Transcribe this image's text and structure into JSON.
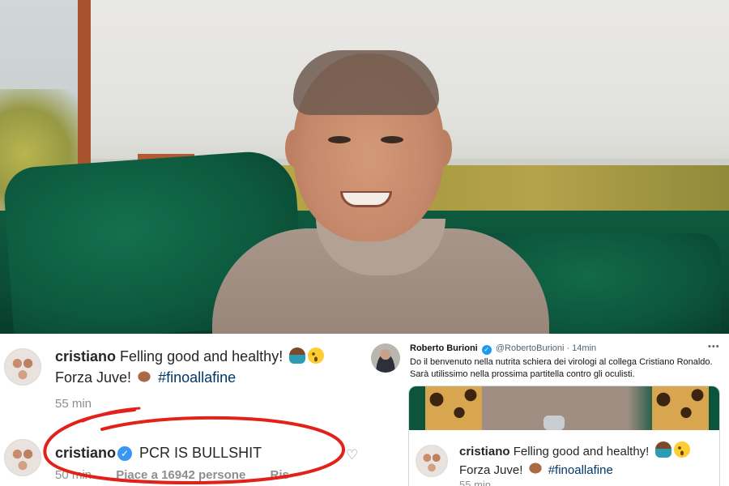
{
  "instagram": {
    "comment1": {
      "user": "cristiano",
      "text": "Felling good and healthy!",
      "emojis": [
        "person-shrugging-emoji",
        "winking-face-emoji"
      ],
      "line2": "Forza Juve!",
      "line2_emoji": "flexed-biceps-emoji",
      "hashtag": "#finoallafine",
      "time": "55 min"
    },
    "comment2": {
      "user": "cristiano",
      "text": "PCR IS BULLSHIT",
      "time": "50 min",
      "likes": "Piace a 16942 persone",
      "reply": "Ris"
    }
  },
  "tweet": {
    "name": "Roberto Burioni",
    "handle": "@RobertoBurioni",
    "time": "· 14min",
    "more": "•••",
    "body": "Do il benvenuto nella nutrita schiera dei virologi al collega Cristiano Ronaldo. Sarà utilissimo nella prossima partitella contro gli oculisti.",
    "card": {
      "user": "cristiano",
      "text": "Felling good and healthy!",
      "line2": "Forza Juve!",
      "hashtag": "#finoallafine",
      "time": "55 min"
    }
  },
  "colors": {
    "annotation_red": "#e3211b",
    "hashtag_blue": "#00376b",
    "verified_blue": "#3897f0",
    "sofa_green": "#0c553c"
  }
}
